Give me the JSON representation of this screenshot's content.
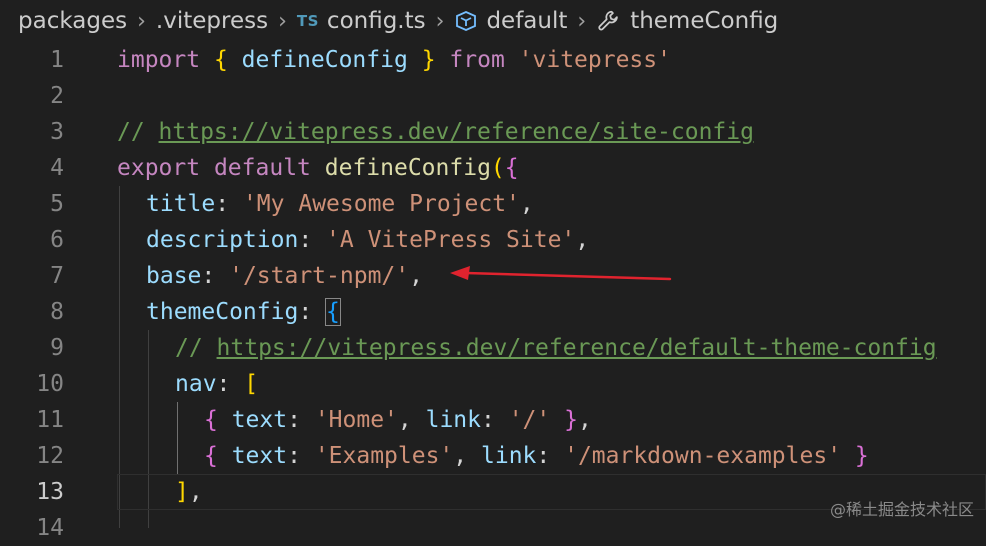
{
  "breadcrumb": {
    "items": [
      "packages",
      ".vitepress",
      "config.ts",
      "default",
      "themeConfig"
    ],
    "ts_badge": "TS"
  },
  "editor": {
    "line_numbers": [
      "1",
      "2",
      "3",
      "4",
      "5",
      "6",
      "7",
      "8",
      "9",
      "10",
      "11",
      "12",
      "13",
      "14"
    ],
    "active_line": "13",
    "tokens": {
      "l1": {
        "import": "import",
        "ob": "{",
        "name": " defineConfig ",
        "cb": "}",
        "from": "from",
        "str": "'vitepress'"
      },
      "l3": {
        "slashes": "// ",
        "url": "https://vitepress.dev/reference/site-config"
      },
      "l4": {
        "export": "export",
        "default": "default",
        "fn": "defineConfig",
        "op": "(",
        "ob": "{"
      },
      "l5": {
        "key": "title",
        "colon": ": ",
        "str": "'My Awesome Project'",
        "comma": ","
      },
      "l6": {
        "key": "description",
        "colon": ": ",
        "str": "'A VitePress Site'",
        "comma": ","
      },
      "l7": {
        "key": "base",
        "colon": ": ",
        "str": "'/start-npm/'",
        "comma": ","
      },
      "l8": {
        "key": "themeConfig",
        "colon": ": ",
        "ob": "{"
      },
      "l9": {
        "slashes": "// ",
        "url": "https://vitepress.dev/reference/default-theme-config"
      },
      "l10": {
        "key": "nav",
        "colon": ": ",
        "ob": "["
      },
      "l11": {
        "ob": "{",
        "k1": " text",
        "c1": ": ",
        "s1": "'Home'",
        "sep": ", ",
        "k2": "link",
        "c2": ": ",
        "s2": "'/'",
        "sp": " ",
        "cb": "}",
        "comma": ","
      },
      "l12": {
        "ob": "{",
        "k1": " text",
        "c1": ": ",
        "s1": "'Examples'",
        "sep": ", ",
        "k2": "link",
        "c2": ": ",
        "s2": "'/markdown-examples'",
        "sp": " ",
        "cb": "}"
      },
      "l13": {
        "cb": "]",
        "comma": ","
      }
    }
  },
  "watermark": "@稀土掘金技术社区",
  "colors": {
    "background": "#1f1f1f",
    "keyword": "#c586c0",
    "property": "#9cdcfe",
    "string": "#ce9178",
    "comment": "#6a9955",
    "function": "#dcdcaa",
    "arrow": "#e0232e"
  }
}
